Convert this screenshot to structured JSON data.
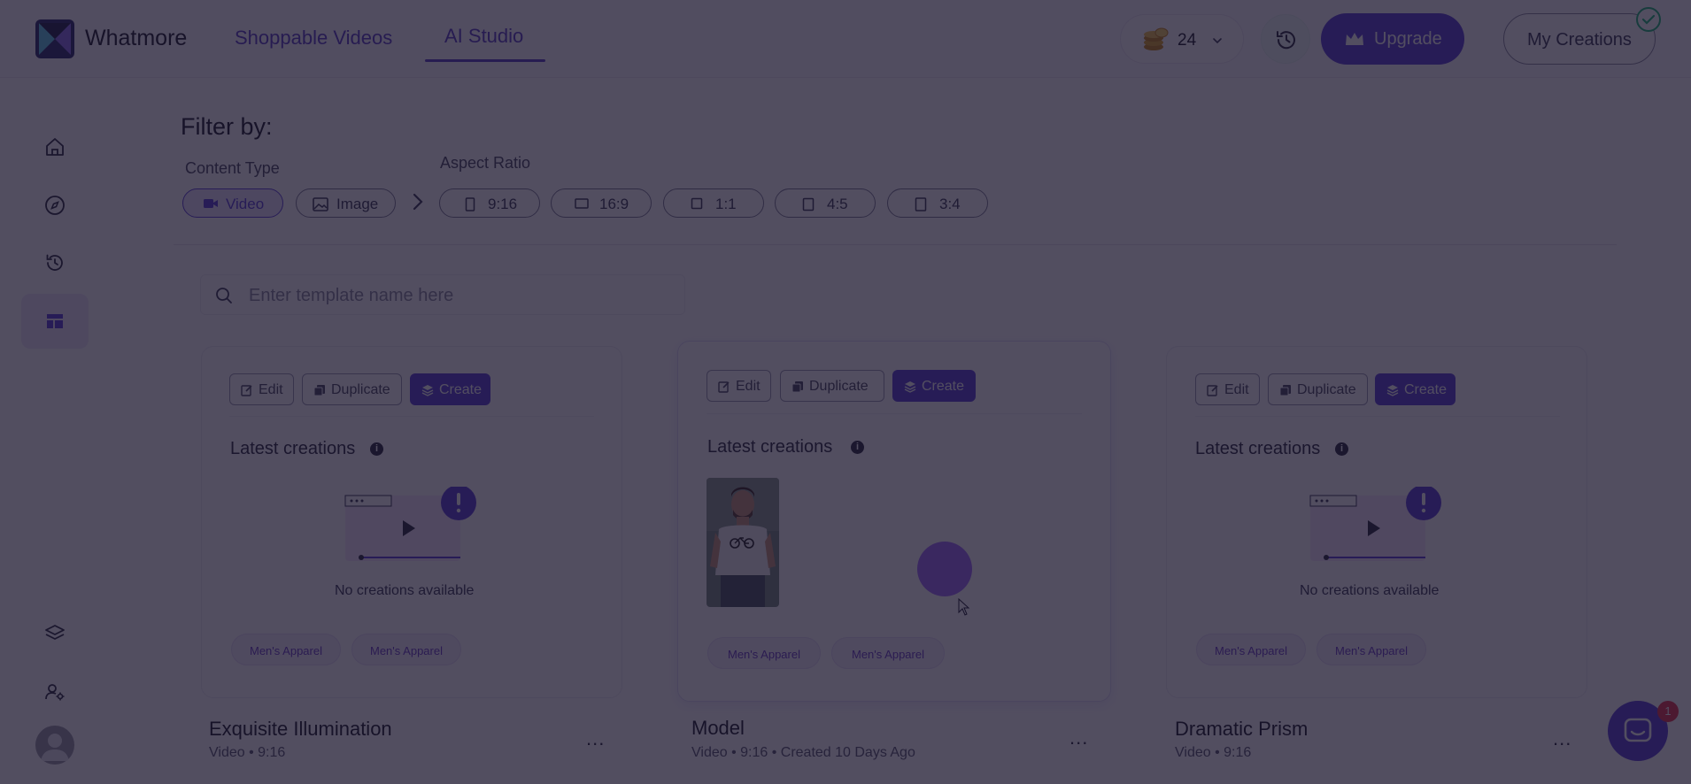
{
  "brand": {
    "name": "Whatmore"
  },
  "nav": {
    "shoppable": "Shoppable Videos",
    "ai_studio": "AI Studio"
  },
  "header": {
    "coins": "24",
    "upgrade_label": "Upgrade",
    "my_creations_label": "My Creations"
  },
  "sidebar": {
    "items": [
      {
        "name": "home-icon"
      },
      {
        "name": "compass-icon"
      },
      {
        "name": "history-icon"
      },
      {
        "name": "templates-icon",
        "active": true
      },
      {
        "name": "layers-icon"
      },
      {
        "name": "user-settings-icon"
      },
      {
        "name": "avatar-icon"
      }
    ]
  },
  "filter": {
    "title": "Filter by:",
    "content_type_label": "Content Type",
    "aspect_ratio_label": "Aspect Ratio",
    "content_types": [
      {
        "label": "Video",
        "icon": "video-icon",
        "selected": true
      },
      {
        "label": "Image",
        "icon": "image-icon",
        "selected": false
      }
    ],
    "aspect_ratios": [
      "9:16",
      "16:9",
      "1:1",
      "4:5",
      "3:4"
    ]
  },
  "search": {
    "placeholder": "Enter template name here",
    "value": ""
  },
  "card_actions": {
    "edit": "Edit",
    "duplicate": "Duplicate",
    "create": "Create"
  },
  "cards": [
    {
      "latest_label": "Latest creations",
      "empty_text": "No creations available",
      "tags": [
        "Men's Apparel",
        "Men's Apparel"
      ],
      "title": "Exquisite Illumination",
      "meta": "Video • 9:16"
    },
    {
      "latest_label": "Latest creations",
      "tags": [
        "Men's Apparel",
        "Men's Apparel"
      ],
      "title": "Model",
      "meta": "Video • 9:16 • Created 10 Days Ago"
    },
    {
      "latest_label": "Latest creations",
      "empty_text": "No creations available",
      "tags": [
        "Men's Apparel",
        "Men's Apparel"
      ],
      "title": "Dramatic Prism",
      "meta": "Video • 9:16"
    }
  ],
  "more_menu": "...",
  "chat": {
    "badge": "1"
  },
  "colors": {
    "accent": "#5b3fd6",
    "overlay": "#161028",
    "success": "#22b97a",
    "badge": "#e8334a"
  }
}
